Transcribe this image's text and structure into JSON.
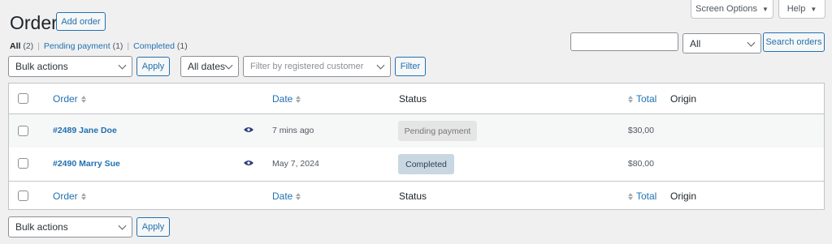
{
  "screen_meta": {
    "screen_options_label": "Screen Options",
    "help_label": "Help"
  },
  "header": {
    "title": "Orders",
    "add_order_label": "Add order"
  },
  "views": [
    {
      "label": "All",
      "count": "(2)"
    },
    {
      "label": "Pending payment",
      "count": "(1)"
    },
    {
      "label": "Completed",
      "count": "(1)"
    }
  ],
  "search": {
    "input_value": "",
    "filter_selected": "All",
    "button_label": "Search orders"
  },
  "top_nav": {
    "bulk_actions": "Bulk actions",
    "apply_label": "Apply",
    "dates_selected": "All dates",
    "customer_placeholder": "Filter by registered customer",
    "filter_label": "Filter"
  },
  "columns": {
    "order": "Order",
    "date": "Date",
    "status": "Status",
    "total": "Total",
    "origin": "Origin"
  },
  "orders": [
    {
      "label": "#2489 Jane Doe",
      "date": "7 mins ago",
      "status": "Pending payment",
      "total": "$30,00",
      "origin": ""
    },
    {
      "label": "#2490 Marry Sue",
      "date": "May 7, 2024",
      "status": "Completed",
      "total": "$80,00",
      "origin": ""
    }
  ],
  "bottom_nav": {
    "bulk_actions": "Bulk actions",
    "apply_label": "Apply"
  },
  "colors": {
    "accent": "#2271b1",
    "pending_bg": "#e5e5e5",
    "completed_bg": "#c8d7e1",
    "background": "#f0f0f1"
  }
}
